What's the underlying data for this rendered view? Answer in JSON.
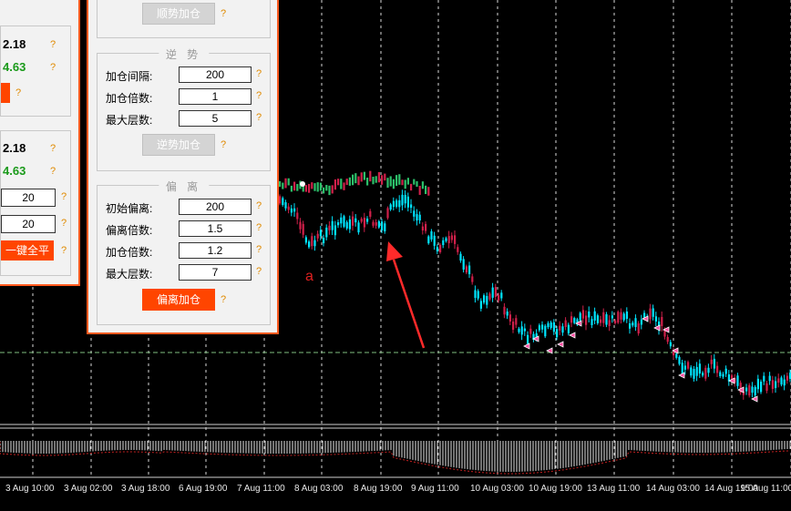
{
  "chart": {
    "x_axis_labels": [
      "3 Aug 10:00",
      "3 Aug 02:00",
      "3 Aug 18:00",
      "6 Aug 19:00",
      "7 Aug 11:00",
      "8 Aug 03:00",
      "8 Aug 19:00",
      "9 Aug 11:00",
      "10 Aug 03:00",
      "10 Aug 19:00",
      "13 Aug 11:00",
      "14 Aug 03:00",
      "14 Aug 19:00",
      "15 Aug 11:00"
    ],
    "annotation_label": "a",
    "colors": {
      "background": "#000000",
      "bull": "#00e5ff",
      "bear": "#d0204a",
      "grid": "#ffffff",
      "arrow": "#ff2a2a",
      "panel_border": "#ff5a1f"
    }
  },
  "left_panel": {
    "value_top_black": "2.18",
    "value_top_green": "4.63",
    "value_bottom_black": "2.18",
    "value_bottom_green": "4.63",
    "input_1": "20",
    "input_2": "20",
    "close_all_label": "一键全平",
    "help_mark": "?"
  },
  "right_panel": {
    "trend_add_button": "顺势加仓",
    "counter_title": "逆 势",
    "counter_rows": [
      {
        "label": "加仓间隔:",
        "value": "200"
      },
      {
        "label": "加仓倍数:",
        "value": "1"
      },
      {
        "label": "最大层数:",
        "value": "5"
      }
    ],
    "counter_add_button": "逆势加仓",
    "deviation_title": "偏 离",
    "deviation_rows": [
      {
        "label": "初始偏离:",
        "value": "200"
      },
      {
        "label": "偏离倍数:",
        "value": "1.5"
      },
      {
        "label": "加仓倍数:",
        "value": "1.2"
      },
      {
        "label": "最大层数:",
        "value": "7"
      }
    ],
    "deviation_add_button": "偏离加仓",
    "help_mark": "?"
  }
}
